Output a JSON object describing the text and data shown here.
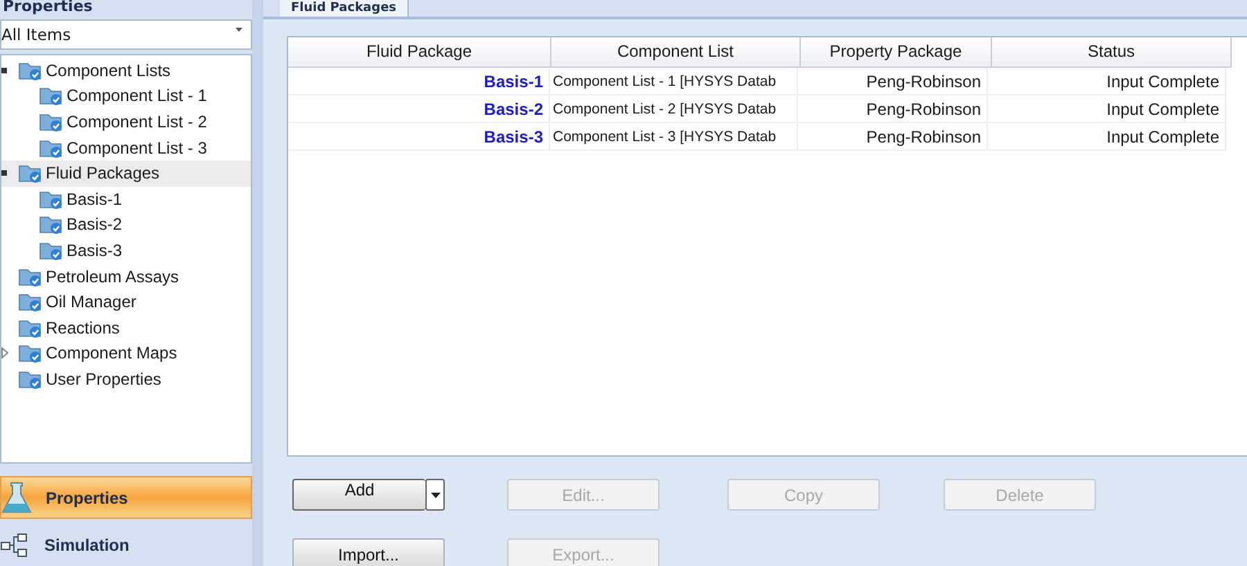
{
  "sidebar": {
    "title": "Properties",
    "filter": "All Items",
    "tree": [
      {
        "label": "Component Lists",
        "expanded": true,
        "selected": false,
        "children": [
          {
            "label": "Component List - 1",
            "selected": false
          },
          {
            "label": "Component List - 2",
            "selected": false
          },
          {
            "label": "Component List - 3",
            "selected": false
          }
        ]
      },
      {
        "label": "Fluid Packages",
        "expanded": true,
        "selected": true,
        "children": [
          {
            "label": "Basis-1",
            "selected": false
          },
          {
            "label": "Basis-2",
            "selected": false
          },
          {
            "label": "Basis-3",
            "selected": false
          }
        ]
      },
      {
        "label": "Petroleum Assays",
        "selected": false
      },
      {
        "label": "Oil Manager",
        "selected": false
      },
      {
        "label": "Reactions",
        "selected": false
      },
      {
        "label": "Component Maps",
        "expanded": false,
        "selected": false
      },
      {
        "label": "User Properties",
        "selected": false
      }
    ],
    "nav": [
      {
        "label": "Properties",
        "kind": "flask",
        "selected": true
      },
      {
        "label": "Simulation",
        "kind": "flowsheet",
        "selected": false
      }
    ]
  },
  "tabs": [
    {
      "label": "Fluid Packages",
      "selected": true
    }
  ],
  "table": {
    "columns": [
      "Fluid Package",
      "Component List",
      "Property Package",
      "Status"
    ],
    "rows": [
      [
        "Basis-1",
        "Component List - 1 [HYSYS Datab",
        "Peng-Robinson",
        "Input Complete"
      ],
      [
        "Basis-2",
        "Component List - 2 [HYSYS Datab",
        "Peng-Robinson",
        "Input Complete"
      ],
      [
        "Basis-3",
        "Component List - 3 [HYSYS Datab",
        "Peng-Robinson",
        "Input Complete"
      ]
    ]
  },
  "buttons": [
    [
      {
        "label": "Add",
        "disabled": false,
        "dropdown": true
      },
      {
        "label": "Edit...",
        "disabled": true
      },
      {
        "label": "Copy",
        "disabled": true
      },
      {
        "label": "Delete",
        "disabled": true
      }
    ],
    [
      {
        "label": "Import...",
        "disabled": false
      },
      {
        "label": "Export...",
        "disabled": true
      }
    ]
  ]
}
